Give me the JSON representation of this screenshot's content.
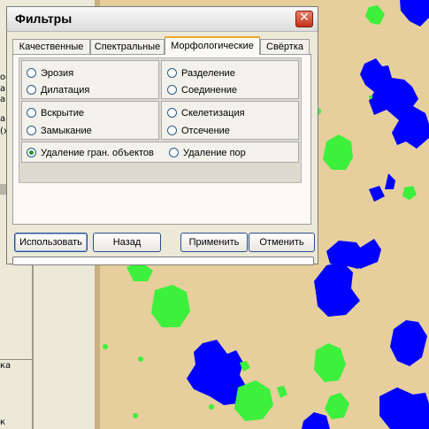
{
  "dialog": {
    "title": "Фильтры",
    "close_icon": "close-icon",
    "tabs": [
      {
        "label": "Качественные",
        "active": false
      },
      {
        "label": "Спектральные",
        "active": false
      },
      {
        "label": "Морфологические",
        "active": true
      },
      {
        "label": "Свёртка",
        "active": false
      }
    ],
    "morphology": {
      "options": [
        {
          "label": "Эрозия",
          "checked": false
        },
        {
          "label": "Дилатация",
          "checked": false
        },
        {
          "label": "Разделение",
          "checked": false
        },
        {
          "label": "Соединение",
          "checked": false
        },
        {
          "label": "Вскрытие",
          "checked": false
        },
        {
          "label": "Замыкание",
          "checked": false
        },
        {
          "label": "Скелетизация",
          "checked": false
        },
        {
          "label": "Отсечение",
          "checked": false
        },
        {
          "label": "Удаление гран. объектов",
          "checked": true
        },
        {
          "label": "Удаление пор",
          "checked": false
        }
      ]
    },
    "buttons": {
      "use": "Использовать",
      "back": "Назад",
      "apply": "Применить",
      "cancel": "Отменить"
    },
    "progress_fraction": 0
  },
  "background_panel": {
    "fragments": [
      "oe",
      "a",
      "a",
      "а.",
      "(x",
      "ка",
      "к"
    ]
  },
  "colors": {
    "image_background": "#e6cf9c",
    "blob_blue": "#0000ff",
    "blob_green": "#3cf03c",
    "tab_active_accent": "#f4a82c",
    "close_button": "#c2331a"
  }
}
